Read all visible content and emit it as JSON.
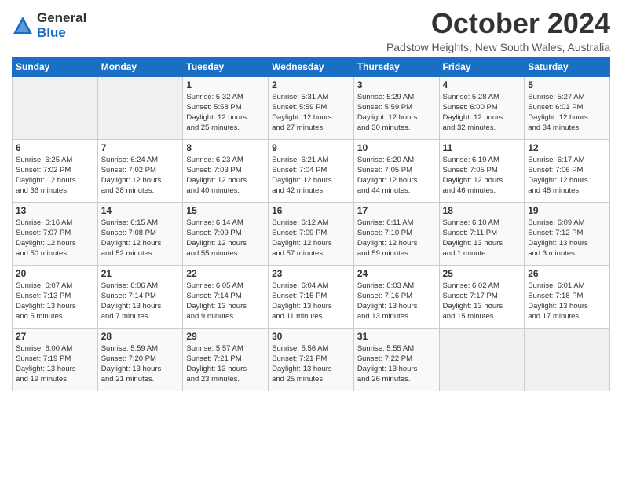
{
  "logo": {
    "general": "General",
    "blue": "Blue"
  },
  "title": "October 2024",
  "subtitle": "Padstow Heights, New South Wales, Australia",
  "days_header": [
    "Sunday",
    "Monday",
    "Tuesday",
    "Wednesday",
    "Thursday",
    "Friday",
    "Saturday"
  ],
  "weeks": [
    [
      {
        "day": "",
        "info": ""
      },
      {
        "day": "",
        "info": ""
      },
      {
        "day": "1",
        "info": "Sunrise: 5:32 AM\nSunset: 5:58 PM\nDaylight: 12 hours\nand 25 minutes."
      },
      {
        "day": "2",
        "info": "Sunrise: 5:31 AM\nSunset: 5:59 PM\nDaylight: 12 hours\nand 27 minutes."
      },
      {
        "day": "3",
        "info": "Sunrise: 5:29 AM\nSunset: 5:59 PM\nDaylight: 12 hours\nand 30 minutes."
      },
      {
        "day": "4",
        "info": "Sunrise: 5:28 AM\nSunset: 6:00 PM\nDaylight: 12 hours\nand 32 minutes."
      },
      {
        "day": "5",
        "info": "Sunrise: 5:27 AM\nSunset: 6:01 PM\nDaylight: 12 hours\nand 34 minutes."
      }
    ],
    [
      {
        "day": "6",
        "info": "Sunrise: 6:25 AM\nSunset: 7:02 PM\nDaylight: 12 hours\nand 36 minutes."
      },
      {
        "day": "7",
        "info": "Sunrise: 6:24 AM\nSunset: 7:02 PM\nDaylight: 12 hours\nand 38 minutes."
      },
      {
        "day": "8",
        "info": "Sunrise: 6:23 AM\nSunset: 7:03 PM\nDaylight: 12 hours\nand 40 minutes."
      },
      {
        "day": "9",
        "info": "Sunrise: 6:21 AM\nSunset: 7:04 PM\nDaylight: 12 hours\nand 42 minutes."
      },
      {
        "day": "10",
        "info": "Sunrise: 6:20 AM\nSunset: 7:05 PM\nDaylight: 12 hours\nand 44 minutes."
      },
      {
        "day": "11",
        "info": "Sunrise: 6:19 AM\nSunset: 7:05 PM\nDaylight: 12 hours\nand 46 minutes."
      },
      {
        "day": "12",
        "info": "Sunrise: 6:17 AM\nSunset: 7:06 PM\nDaylight: 12 hours\nand 48 minutes."
      }
    ],
    [
      {
        "day": "13",
        "info": "Sunrise: 6:16 AM\nSunset: 7:07 PM\nDaylight: 12 hours\nand 50 minutes."
      },
      {
        "day": "14",
        "info": "Sunrise: 6:15 AM\nSunset: 7:08 PM\nDaylight: 12 hours\nand 52 minutes."
      },
      {
        "day": "15",
        "info": "Sunrise: 6:14 AM\nSunset: 7:09 PM\nDaylight: 12 hours\nand 55 minutes."
      },
      {
        "day": "16",
        "info": "Sunrise: 6:12 AM\nSunset: 7:09 PM\nDaylight: 12 hours\nand 57 minutes."
      },
      {
        "day": "17",
        "info": "Sunrise: 6:11 AM\nSunset: 7:10 PM\nDaylight: 12 hours\nand 59 minutes."
      },
      {
        "day": "18",
        "info": "Sunrise: 6:10 AM\nSunset: 7:11 PM\nDaylight: 13 hours\nand 1 minute."
      },
      {
        "day": "19",
        "info": "Sunrise: 6:09 AM\nSunset: 7:12 PM\nDaylight: 13 hours\nand 3 minutes."
      }
    ],
    [
      {
        "day": "20",
        "info": "Sunrise: 6:07 AM\nSunset: 7:13 PM\nDaylight: 13 hours\nand 5 minutes."
      },
      {
        "day": "21",
        "info": "Sunrise: 6:06 AM\nSunset: 7:14 PM\nDaylight: 13 hours\nand 7 minutes."
      },
      {
        "day": "22",
        "info": "Sunrise: 6:05 AM\nSunset: 7:14 PM\nDaylight: 13 hours\nand 9 minutes."
      },
      {
        "day": "23",
        "info": "Sunrise: 6:04 AM\nSunset: 7:15 PM\nDaylight: 13 hours\nand 11 minutes."
      },
      {
        "day": "24",
        "info": "Sunrise: 6:03 AM\nSunset: 7:16 PM\nDaylight: 13 hours\nand 13 minutes."
      },
      {
        "day": "25",
        "info": "Sunrise: 6:02 AM\nSunset: 7:17 PM\nDaylight: 13 hours\nand 15 minutes."
      },
      {
        "day": "26",
        "info": "Sunrise: 6:01 AM\nSunset: 7:18 PM\nDaylight: 13 hours\nand 17 minutes."
      }
    ],
    [
      {
        "day": "27",
        "info": "Sunrise: 6:00 AM\nSunset: 7:19 PM\nDaylight: 13 hours\nand 19 minutes."
      },
      {
        "day": "28",
        "info": "Sunrise: 5:59 AM\nSunset: 7:20 PM\nDaylight: 13 hours\nand 21 minutes."
      },
      {
        "day": "29",
        "info": "Sunrise: 5:57 AM\nSunset: 7:21 PM\nDaylight: 13 hours\nand 23 minutes."
      },
      {
        "day": "30",
        "info": "Sunrise: 5:56 AM\nSunset: 7:21 PM\nDaylight: 13 hours\nand 25 minutes."
      },
      {
        "day": "31",
        "info": "Sunrise: 5:55 AM\nSunset: 7:22 PM\nDaylight: 13 hours\nand 26 minutes."
      },
      {
        "day": "",
        "info": ""
      },
      {
        "day": "",
        "info": ""
      }
    ]
  ]
}
